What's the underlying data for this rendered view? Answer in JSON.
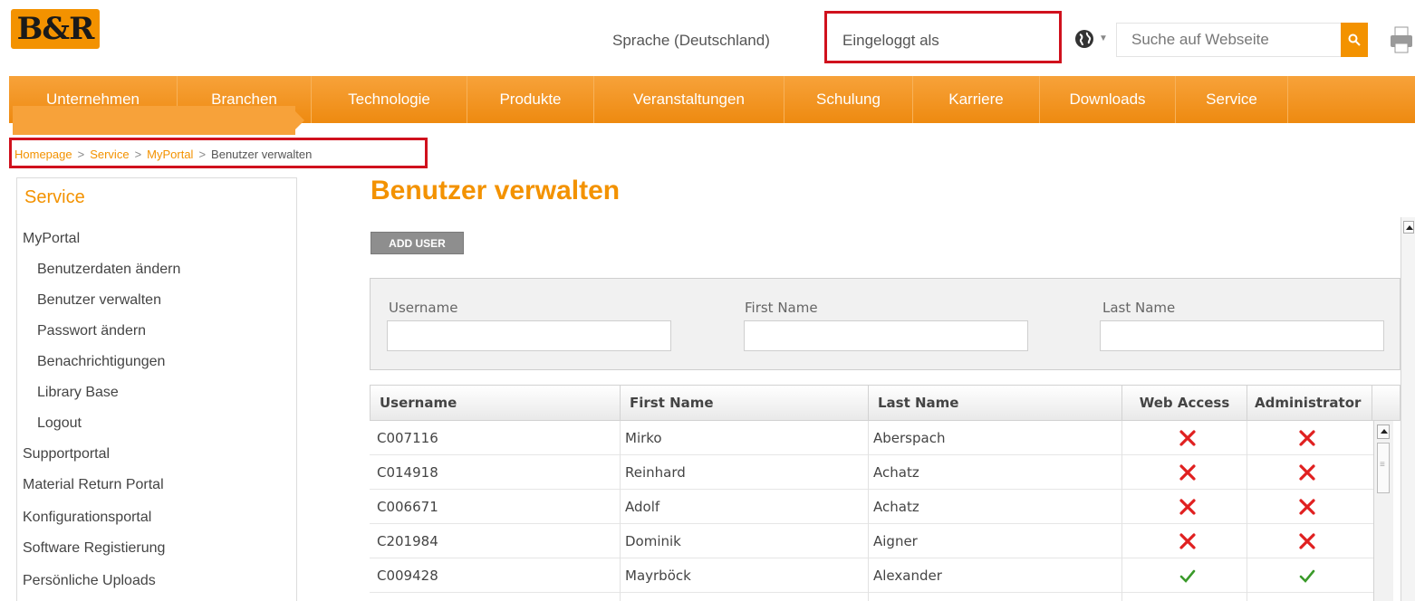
{
  "header": {
    "logo_text": "B&R",
    "language_label": "Sprache (Deutschland)",
    "login_label": "Eingeloggt als",
    "search_placeholder": "Suche auf Webseite"
  },
  "nav": {
    "items": [
      "Unternehmen",
      "Branchen",
      "Technologie",
      "Produkte",
      "Veranstaltungen",
      "Schulung",
      "Karriere",
      "Downloads",
      "Service"
    ]
  },
  "breadcrumb": {
    "items": [
      "Homepage",
      "Service",
      "MyPortal"
    ],
    "current": "Benutzer verwalten"
  },
  "sidebar": {
    "title": "Service",
    "myportal": "MyPortal",
    "subitems": [
      "Benutzerdaten ändern",
      "Benutzer verwalten",
      "Passwort ändern",
      "Benachrichtigungen",
      "Library Base",
      "Logout"
    ],
    "sections": [
      "Supportportal",
      "Material Return Portal",
      "Konfigurationsportal",
      "Software Registierung",
      "Persönliche Uploads"
    ],
    "active_index": 1
  },
  "main": {
    "title": "Benutzer verwalten",
    "add_user_label": "ADD USER",
    "filter": {
      "username_label": "Username",
      "firstname_label": "First Name",
      "lastname_label": "Last Name",
      "username_value": "",
      "firstname_value": "",
      "lastname_value": ""
    },
    "table": {
      "columns": [
        "Username",
        "First Name",
        "Last Name",
        "Web Access",
        "Administrator"
      ],
      "rows": [
        {
          "username": "C007116",
          "first": "Mirko",
          "last": "Aberspach",
          "web_access": false,
          "admin": false
        },
        {
          "username": "C014918",
          "first": "Reinhard",
          "last": "Achatz",
          "web_access": false,
          "admin": false
        },
        {
          "username": "C006671",
          "first": "Adolf",
          "last": "Achatz",
          "web_access": false,
          "admin": false
        },
        {
          "username": "C201984",
          "first": "Dominik",
          "last": "Aigner",
          "web_access": false,
          "admin": false
        },
        {
          "username": "C009428",
          "first": "Mayrböck",
          "last": "Alexander",
          "web_access": true,
          "admin": true
        }
      ]
    }
  },
  "colors": {
    "accent": "#f39200",
    "highlight_box": "#d0111d",
    "cross": "#e02020",
    "check": "#3a9a2a"
  }
}
